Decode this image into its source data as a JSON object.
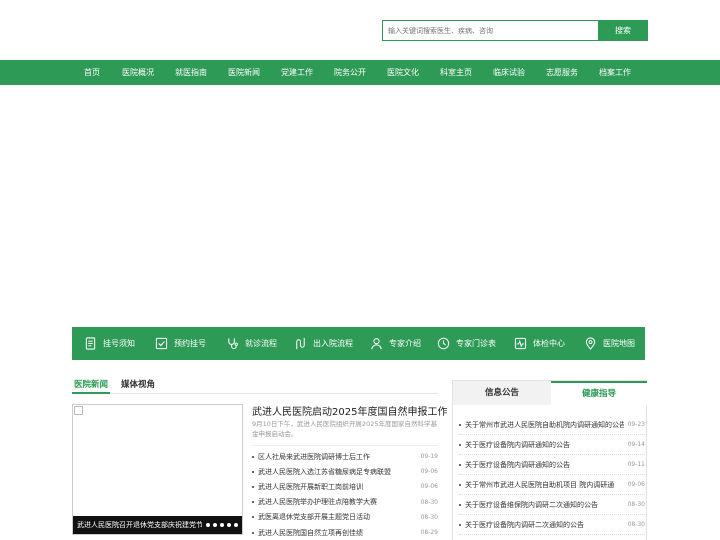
{
  "search": {
    "placeholder": "输入关键词搜索医生、疾病、咨询",
    "button": "搜索"
  },
  "nav": {
    "items": [
      "首页",
      "医院概况",
      "就医指南",
      "医院新闻",
      "党建工作",
      "院务公开",
      "医院文化",
      "科室主页",
      "临床试验",
      "志愿服务",
      "档案工作"
    ]
  },
  "quick_links": {
    "items": [
      {
        "label": "挂号须知",
        "icon": "document-icon"
      },
      {
        "label": "预约挂号",
        "icon": "checkbox-icon"
      },
      {
        "label": "就诊流程",
        "icon": "stethoscope-icon"
      },
      {
        "label": "出入院流程",
        "icon": "route-icon"
      },
      {
        "label": "专家介绍",
        "icon": "person-icon"
      },
      {
        "label": "专家门诊表",
        "icon": "clock-icon"
      },
      {
        "label": "体检中心",
        "icon": "pulse-icon"
      },
      {
        "label": "医院地图",
        "icon": "map-pin-icon"
      }
    ]
  },
  "news": {
    "tab_news": "医院新闻",
    "tab_media": "媒体视角",
    "slide_caption": "武进人民医院召开退休党支部庆祝建党节主题党日活动",
    "headline": "武进人民医院启动2025年度国自然申报工作",
    "summary": "9月10日下午，武进人民医院组织开展2025年度国家自然科学基金申报启动会。",
    "items": [
      {
        "title": "区人社局来武进医院调研博士后工作",
        "date": "09-19"
      },
      {
        "title": "武进人民医院入选江苏省糖尿病足专病联盟",
        "date": "09-06"
      },
      {
        "title": "武进人民医院开展新职工岗前培训",
        "date": "09-06"
      },
      {
        "title": "武进人民医院举办护理驻点陪教学大赛",
        "date": "08-30"
      },
      {
        "title": "武医离退休党支部开展主题党日活动",
        "date": "08-30"
      },
      {
        "title": "武进人民医院国自然立项再创佳绩",
        "date": "08-29"
      }
    ]
  },
  "notice": {
    "tab_info": "信息公告",
    "tab_health": "健康指导",
    "items": [
      {
        "title": "关于常州市武进人民医院自助机院内调研通知的公告",
        "date": "09-23"
      },
      {
        "title": "关于医疗设备院内调研通知的公告",
        "date": "09-14"
      },
      {
        "title": "关于医疗设备院内调研通知的公告",
        "date": "09-11"
      },
      {
        "title": "关于常州市武进人民医院自助机项目 院内调研通",
        "date": "09-06"
      },
      {
        "title": "关于医疗设备维保院内调研二次通知的公告",
        "date": "08-30"
      },
      {
        "title": "关于医疗设备院内调研二次通知的公告",
        "date": "08-30"
      }
    ]
  },
  "colors": {
    "brand_green": "#2d9a56"
  }
}
